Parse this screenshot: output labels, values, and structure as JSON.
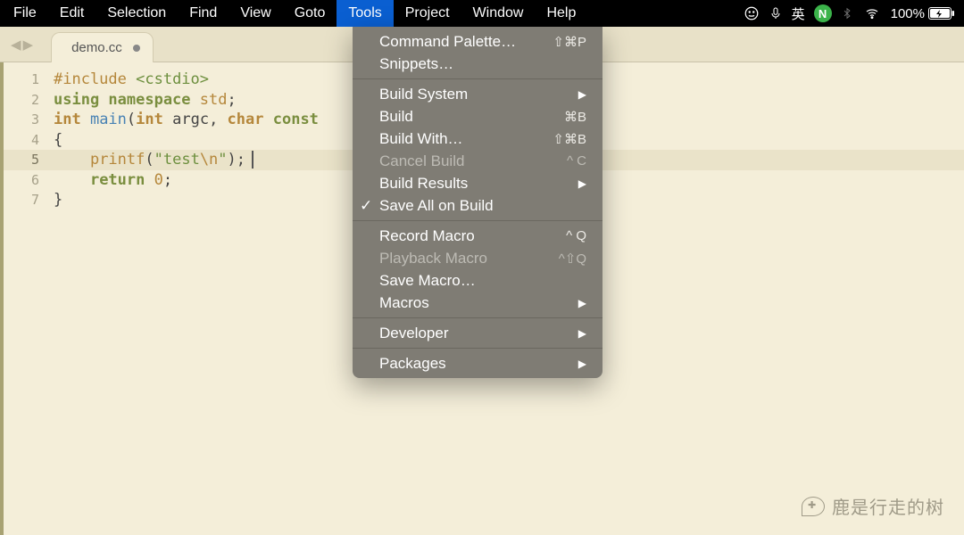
{
  "menubar": {
    "items": [
      "File",
      "Edit",
      "Selection",
      "Find",
      "View",
      "Goto",
      "Tools",
      "Project",
      "Window",
      "Help"
    ],
    "active_index": 6
  },
  "tray": {
    "ime": "英",
    "n_badge": "N",
    "battery_pct": "100%"
  },
  "tab": {
    "filename": "demo.cc",
    "dirty": true
  },
  "editor": {
    "current_line": 5,
    "lines": [
      {
        "n": 1,
        "tokens": [
          [
            "pre",
            "#include "
          ],
          [
            "inc",
            "<cstdio>"
          ]
        ]
      },
      {
        "n": 2,
        "tokens": [
          [
            "kw",
            "using namespace "
          ],
          [
            "pre",
            "std"
          ],
          [
            "punct",
            ";"
          ]
        ]
      },
      {
        "n": 3,
        "tokens": [
          [
            "kw2",
            "int "
          ],
          [
            "func",
            "main"
          ],
          [
            "punct",
            "("
          ],
          [
            "kw2",
            "int "
          ],
          [
            "iden",
            "argc"
          ],
          [
            "punct",
            ", "
          ],
          [
            "kw2",
            "char "
          ],
          [
            "kw",
            "const"
          ]
        ]
      },
      {
        "n": 4,
        "tokens": [
          [
            "punct",
            "{"
          ]
        ]
      },
      {
        "n": 5,
        "tokens": [
          [
            "iden",
            "    "
          ],
          [
            "pre",
            "printf"
          ],
          [
            "punct",
            "("
          ],
          [
            "str",
            "\"test"
          ],
          [
            "esc",
            "\\n"
          ],
          [
            "str",
            "\""
          ],
          [
            "punct",
            ");"
          ]
        ]
      },
      {
        "n": 6,
        "tokens": [
          [
            "iden",
            "    "
          ],
          [
            "kw",
            "return "
          ],
          [
            "num",
            "0"
          ],
          [
            "punct",
            ";"
          ]
        ]
      },
      {
        "n": 7,
        "tokens": [
          [
            "punct",
            "}"
          ]
        ]
      }
    ]
  },
  "dropdown": {
    "sections": [
      [
        {
          "label": "Command Palette…",
          "accel": "⇧⌘P"
        },
        {
          "label": "Snippets…"
        }
      ],
      [
        {
          "label": "Build System",
          "sub": true
        },
        {
          "label": "Build",
          "accel": "⌘B"
        },
        {
          "label": "Build With…",
          "accel": "⇧⌘B"
        },
        {
          "label": "Cancel Build",
          "accel": "^ C",
          "disabled": true
        },
        {
          "label": "Build Results",
          "sub": true
        },
        {
          "label": "Save All on Build",
          "checked": true
        }
      ],
      [
        {
          "label": "Record Macro",
          "accel": "^ Q"
        },
        {
          "label": "Playback Macro",
          "accel": "^⇧Q",
          "disabled": true
        },
        {
          "label": "Save Macro…"
        },
        {
          "label": "Macros",
          "sub": true
        }
      ],
      [
        {
          "label": "Developer",
          "sub": true
        }
      ],
      [
        {
          "label": "Packages",
          "sub": true
        }
      ]
    ]
  },
  "watermark": {
    "text": "鹿是行走的树"
  }
}
